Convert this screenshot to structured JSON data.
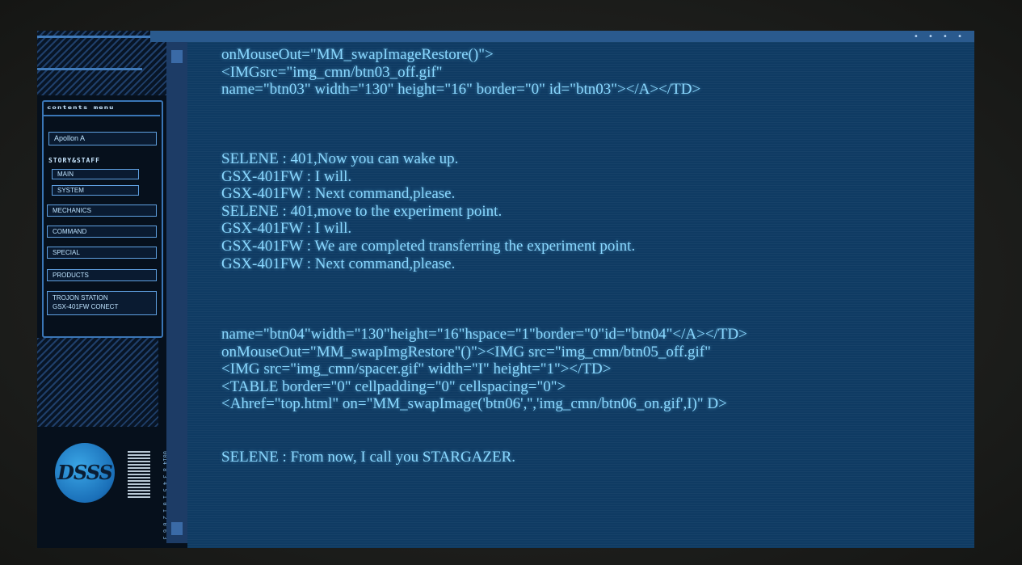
{
  "sidebar": {
    "menu_title": "contents menu",
    "apollo_label": "Apollon  A",
    "story_label": "STORY&STAFF",
    "items": [
      {
        "label": "MAIN"
      },
      {
        "label": "SYSTEM"
      },
      {
        "label": "MECHANICS"
      },
      {
        "label": "COMMAND"
      },
      {
        "label": "SPECIAL"
      },
      {
        "label": "PRODUCTS"
      }
    ],
    "trojon_line1": "TROJON  STATION",
    "trojon_line2": "GSX-401FW  CONECT",
    "logo_text": "DSSS",
    "vertical_code": "0014 8 3 4 5 1 0 1 2 0 6 3"
  },
  "header": {
    "dots": "• • • •"
  },
  "code": {
    "lines": [
      "onMouseOut=\"MM_swapImageRestore()\">",
      "<IMGsrc=\"img_cmn/btn03_off.gif\"",
      "name=\"btn03\" width=\"130\" height=\"16\" border=\"0\" id=\"btn03\"></A></TD>",
      "SELENE : 401,Now you can wake up.",
      "GSX-401FW : I will.",
      "GSX-401FW : Next command,please.",
      "SELENE : 401,move to the experiment point.",
      "GSX-401FW : I will.",
      "GSX-401FW : We are completed transferring the experiment point.",
      "GSX-401FW : Next command,please.",
      "name=\"btn04\"width=\"130\"height=\"16\"hspace=\"1\"border=\"0\"id=\"btn04\"</A></TD>",
      "onMouseOut=\"MM_swapImgRestore\"()\"><IMG src=\"img_cmn/btn05_off.gif\"",
      "<IMG src=\"img_cmn/spacer.gif\" width=\"I\" height=\"1\"></TD>",
      "<TABLE border=\"0\" cellpadding=\"0\" cellspacing=\"0\">",
      "<Ahref=\"top.html\" on=\"MM_swapImage('btn06','','img_cmn/btn06_on.gif',I)\" D>",
      "SELENE : From now, I call you STARGAZER."
    ]
  }
}
